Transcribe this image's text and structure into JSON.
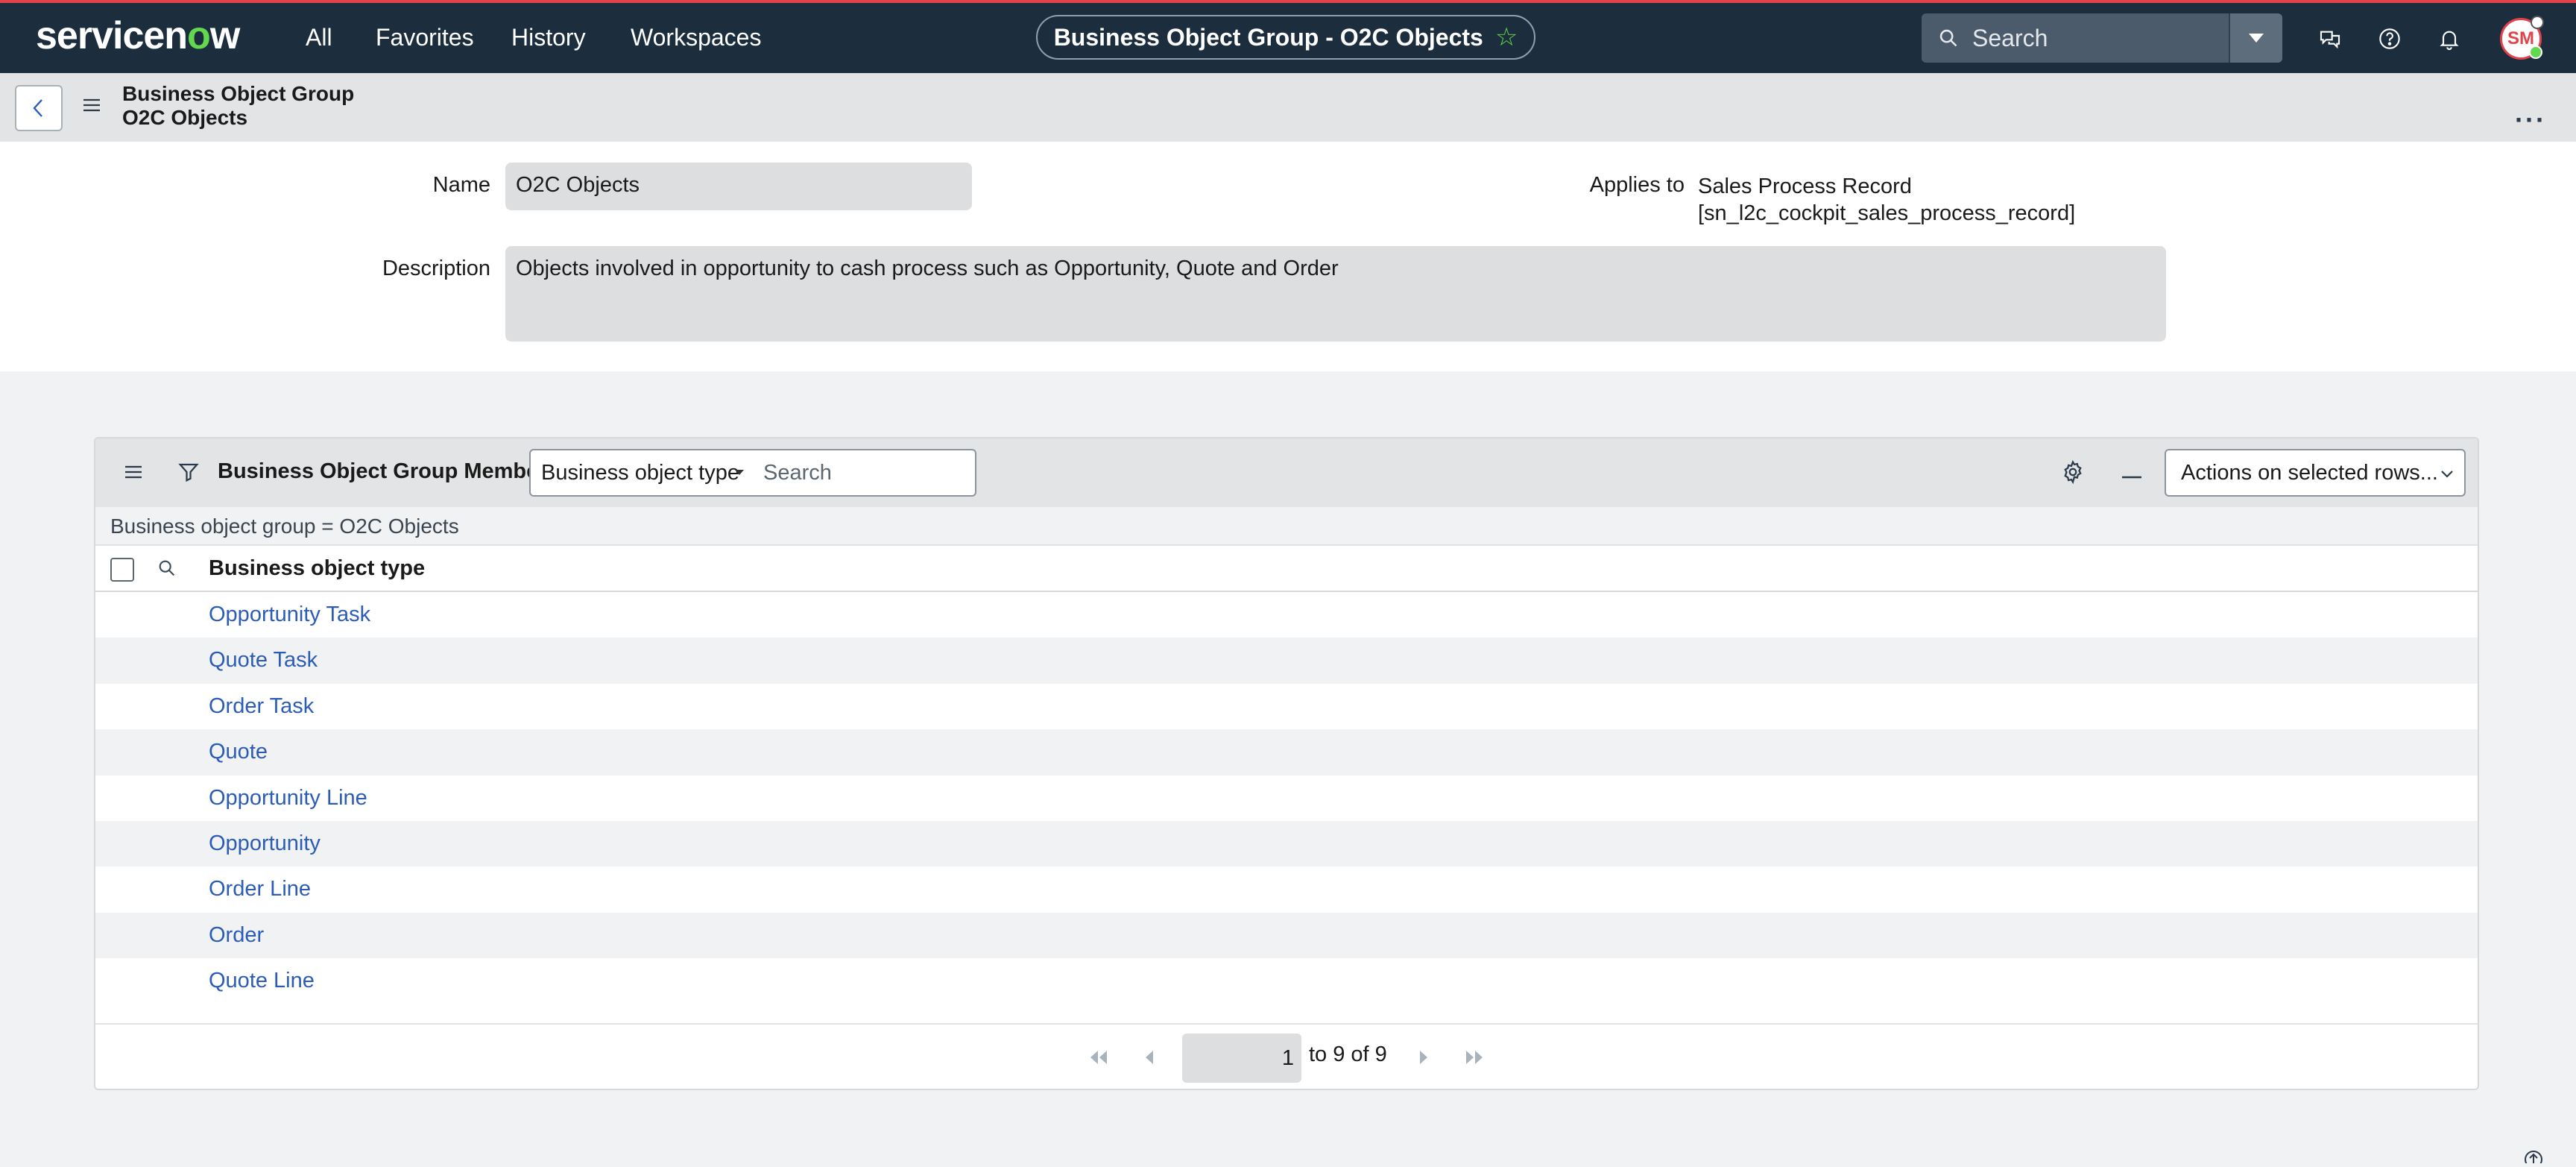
{
  "topbar": {
    "logo": "servicenow",
    "nav": [
      "All",
      "Favorites",
      "History",
      "Workspaces"
    ],
    "record_title": "Business Object Group - O2C Objects",
    "search_placeholder": "Search",
    "user_initials": "SM",
    "icons": [
      "chat-icon",
      "help-icon",
      "bell-icon"
    ]
  },
  "record_header": {
    "line1": "Business Object Group",
    "line2": "O2C Objects"
  },
  "form": {
    "name_label": "Name",
    "name_value": "O2C Objects",
    "description_label": "Description",
    "description_value": "Objects involved in opportunity to cash process such as Opportunity, Quote and Order",
    "applies_label": "Applies to",
    "applies_line1": "Sales Process Record",
    "applies_line2": "[sn_l2c_cockpit_sales_process_record]"
  },
  "related_list": {
    "title": "Business Object Group Members",
    "search_field": "Business object type",
    "search_placeholder": "Search",
    "actions_label": "Actions on selected rows...",
    "filter_text": "Business object group = O2C Objects",
    "column_header": "Business object type",
    "rows": [
      "Opportunity Task",
      "Quote Task",
      "Order Task",
      "Quote",
      "Opportunity Line",
      "Opportunity",
      "Order Line",
      "Order",
      "Quote Line"
    ],
    "pagination": {
      "current": "1",
      "text": "to 9 of 9"
    }
  }
}
